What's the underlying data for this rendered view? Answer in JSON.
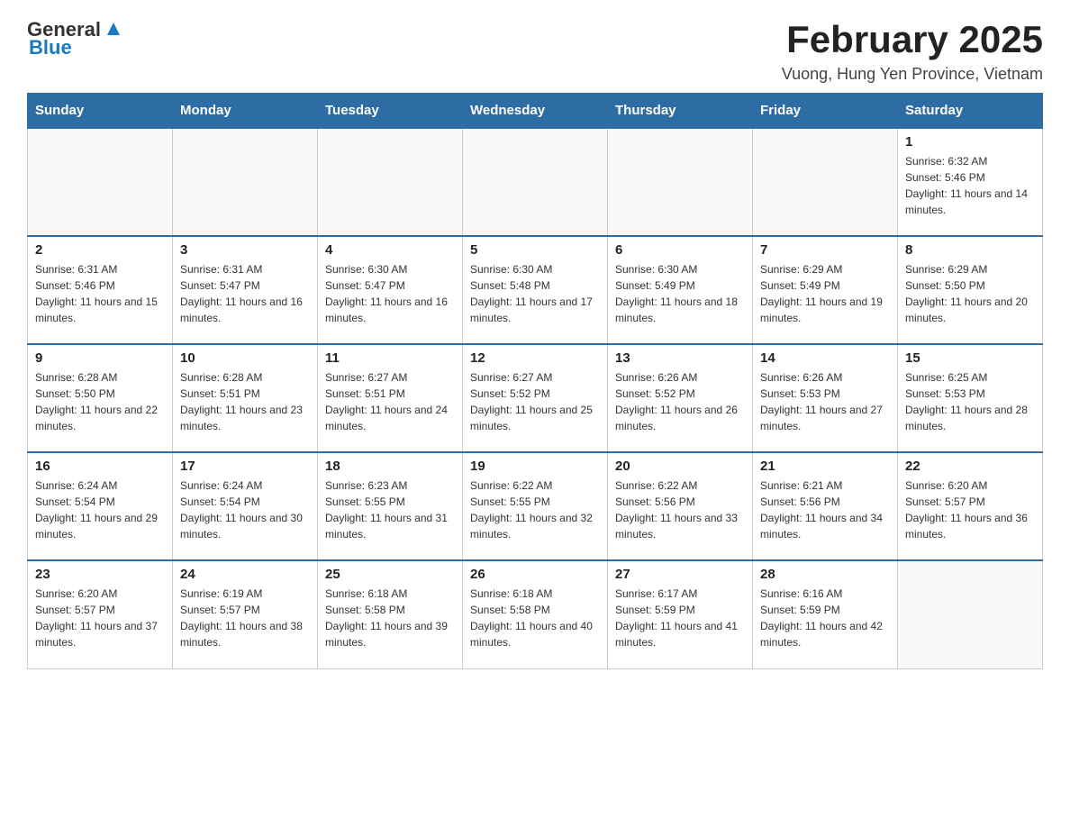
{
  "header": {
    "logo_text_general": "General",
    "logo_text_blue": "Blue",
    "month_title": "February 2025",
    "location": "Vuong, Hung Yen Province, Vietnam"
  },
  "weekdays": [
    "Sunday",
    "Monday",
    "Tuesday",
    "Wednesday",
    "Thursday",
    "Friday",
    "Saturday"
  ],
  "weeks": [
    [
      {
        "day": "",
        "info": ""
      },
      {
        "day": "",
        "info": ""
      },
      {
        "day": "",
        "info": ""
      },
      {
        "day": "",
        "info": ""
      },
      {
        "day": "",
        "info": ""
      },
      {
        "day": "",
        "info": ""
      },
      {
        "day": "1",
        "info": "Sunrise: 6:32 AM\nSunset: 5:46 PM\nDaylight: 11 hours and 14 minutes."
      }
    ],
    [
      {
        "day": "2",
        "info": "Sunrise: 6:31 AM\nSunset: 5:46 PM\nDaylight: 11 hours and 15 minutes."
      },
      {
        "day": "3",
        "info": "Sunrise: 6:31 AM\nSunset: 5:47 PM\nDaylight: 11 hours and 16 minutes."
      },
      {
        "day": "4",
        "info": "Sunrise: 6:30 AM\nSunset: 5:47 PM\nDaylight: 11 hours and 16 minutes."
      },
      {
        "day": "5",
        "info": "Sunrise: 6:30 AM\nSunset: 5:48 PM\nDaylight: 11 hours and 17 minutes."
      },
      {
        "day": "6",
        "info": "Sunrise: 6:30 AM\nSunset: 5:49 PM\nDaylight: 11 hours and 18 minutes."
      },
      {
        "day": "7",
        "info": "Sunrise: 6:29 AM\nSunset: 5:49 PM\nDaylight: 11 hours and 19 minutes."
      },
      {
        "day": "8",
        "info": "Sunrise: 6:29 AM\nSunset: 5:50 PM\nDaylight: 11 hours and 20 minutes."
      }
    ],
    [
      {
        "day": "9",
        "info": "Sunrise: 6:28 AM\nSunset: 5:50 PM\nDaylight: 11 hours and 22 minutes."
      },
      {
        "day": "10",
        "info": "Sunrise: 6:28 AM\nSunset: 5:51 PM\nDaylight: 11 hours and 23 minutes."
      },
      {
        "day": "11",
        "info": "Sunrise: 6:27 AM\nSunset: 5:51 PM\nDaylight: 11 hours and 24 minutes."
      },
      {
        "day": "12",
        "info": "Sunrise: 6:27 AM\nSunset: 5:52 PM\nDaylight: 11 hours and 25 minutes."
      },
      {
        "day": "13",
        "info": "Sunrise: 6:26 AM\nSunset: 5:52 PM\nDaylight: 11 hours and 26 minutes."
      },
      {
        "day": "14",
        "info": "Sunrise: 6:26 AM\nSunset: 5:53 PM\nDaylight: 11 hours and 27 minutes."
      },
      {
        "day": "15",
        "info": "Sunrise: 6:25 AM\nSunset: 5:53 PM\nDaylight: 11 hours and 28 minutes."
      }
    ],
    [
      {
        "day": "16",
        "info": "Sunrise: 6:24 AM\nSunset: 5:54 PM\nDaylight: 11 hours and 29 minutes."
      },
      {
        "day": "17",
        "info": "Sunrise: 6:24 AM\nSunset: 5:54 PM\nDaylight: 11 hours and 30 minutes."
      },
      {
        "day": "18",
        "info": "Sunrise: 6:23 AM\nSunset: 5:55 PM\nDaylight: 11 hours and 31 minutes."
      },
      {
        "day": "19",
        "info": "Sunrise: 6:22 AM\nSunset: 5:55 PM\nDaylight: 11 hours and 32 minutes."
      },
      {
        "day": "20",
        "info": "Sunrise: 6:22 AM\nSunset: 5:56 PM\nDaylight: 11 hours and 33 minutes."
      },
      {
        "day": "21",
        "info": "Sunrise: 6:21 AM\nSunset: 5:56 PM\nDaylight: 11 hours and 34 minutes."
      },
      {
        "day": "22",
        "info": "Sunrise: 6:20 AM\nSunset: 5:57 PM\nDaylight: 11 hours and 36 minutes."
      }
    ],
    [
      {
        "day": "23",
        "info": "Sunrise: 6:20 AM\nSunset: 5:57 PM\nDaylight: 11 hours and 37 minutes."
      },
      {
        "day": "24",
        "info": "Sunrise: 6:19 AM\nSunset: 5:57 PM\nDaylight: 11 hours and 38 minutes."
      },
      {
        "day": "25",
        "info": "Sunrise: 6:18 AM\nSunset: 5:58 PM\nDaylight: 11 hours and 39 minutes."
      },
      {
        "day": "26",
        "info": "Sunrise: 6:18 AM\nSunset: 5:58 PM\nDaylight: 11 hours and 40 minutes."
      },
      {
        "day": "27",
        "info": "Sunrise: 6:17 AM\nSunset: 5:59 PM\nDaylight: 11 hours and 41 minutes."
      },
      {
        "day": "28",
        "info": "Sunrise: 6:16 AM\nSunset: 5:59 PM\nDaylight: 11 hours and 42 minutes."
      },
      {
        "day": "",
        "info": ""
      }
    ]
  ]
}
